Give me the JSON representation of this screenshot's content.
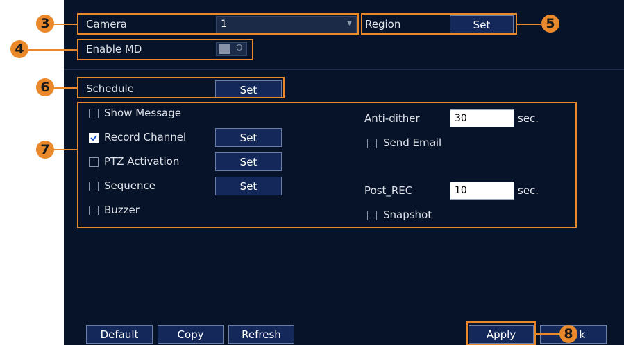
{
  "camera": {
    "label": "Camera",
    "value": "1"
  },
  "region": {
    "label": "Region",
    "button": "Set"
  },
  "enable_md": {
    "label": "Enable MD",
    "toggle_text": "O"
  },
  "schedule": {
    "label": "Schedule",
    "button": "Set"
  },
  "actions": {
    "show_message": {
      "label": "Show Message",
      "checked": false
    },
    "record_channel": {
      "label": "Record Channel",
      "checked": true,
      "button": "Set"
    },
    "ptz_activation": {
      "label": "PTZ Activation",
      "checked": false,
      "button": "Set"
    },
    "sequence": {
      "label": "Sequence",
      "checked": false,
      "button": "Set"
    },
    "buzzer": {
      "label": "Buzzer",
      "checked": false
    },
    "anti_dither": {
      "label": "Anti-dither",
      "value": "30",
      "unit": "sec."
    },
    "send_email": {
      "label": "Send Email",
      "checked": false
    },
    "post_rec": {
      "label": "Post_REC",
      "value": "10",
      "unit": "sec."
    },
    "snapshot": {
      "label": "Snapshot",
      "checked": false
    }
  },
  "footer": {
    "default": "Default",
    "copy": "Copy",
    "refresh": "Refresh",
    "apply": "Apply",
    "back_partial": "k"
  },
  "callouts": {
    "c3": "3",
    "c4": "4",
    "c5": "5",
    "c6": "6",
    "c7": "7",
    "c8": "8"
  },
  "colors": {
    "panel_bg": "#071329",
    "button_bg": "#14295a",
    "callout": "#e9892b"
  }
}
